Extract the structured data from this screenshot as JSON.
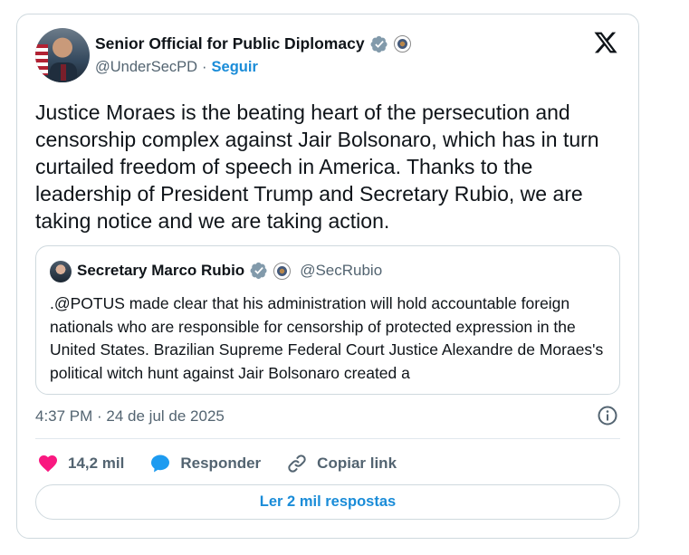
{
  "author": {
    "name": "Senior Official for Public Diplomacy",
    "handle": "@UnderSecPD",
    "separator": "·",
    "follow_label": "Seguir"
  },
  "icons": {
    "verified": "verified-badge-icon",
    "seal": "department-seal-icon",
    "x_logo": "x-logo-icon",
    "info": "info-icon",
    "like": "heart-icon",
    "reply": "speech-bubble-icon",
    "link": "link-icon"
  },
  "tweet": {
    "text": "Justice Moraes is the beating heart of the persecution and censorship complex against Jair Bolsonaro, which has in turn curtailed freedom of speech in America. Thanks to the leadership of President Trump and Secretary Rubio, we are taking notice and we are taking action."
  },
  "quote": {
    "name": "Secretary Marco Rubio",
    "handle": "@SecRubio",
    "text": ".@POTUS made clear that his administration will hold accountable foreign nationals who are responsible for censorship of protected expression in the United States. Brazilian Supreme Federal Court Justice Alexandre de Moraes's political witch hunt against Jair Bolsonaro created a"
  },
  "timestamp": "4:37 PM · 24 de jul de 2025",
  "actions": {
    "like_count": "14,2 mil",
    "reply_label": "Responder",
    "copy_link_label": "Copiar link"
  },
  "read_replies_label": "Ler 2 mil respostas",
  "colors": {
    "accent": "#1a8cd8",
    "verified": "#829aab",
    "like": "#f91880",
    "text": "#0f1419",
    "muted": "#536471",
    "border": "#cfd9de"
  }
}
